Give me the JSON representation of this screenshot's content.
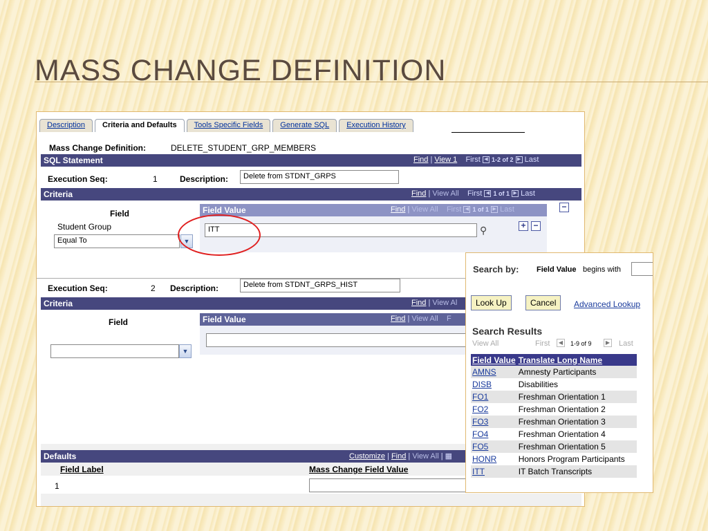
{
  "slide": {
    "title": "MASS CHANGE DEFINITION"
  },
  "tabs": [
    "Description",
    "Criteria and Defaults",
    "Tools Specific Fields",
    "Generate SQL",
    "Execution History"
  ],
  "definition": {
    "label": "Mass Change Definition:",
    "value": "DELETE_STUDENT_GRP_MEMBERS"
  },
  "sql_bar": {
    "title": "SQL Statement",
    "find": "Find",
    "sep": "|",
    "view": "View 1",
    "first": "First",
    "count": "1-2 of 2",
    "last": "Last"
  },
  "exec1": {
    "seq_label": "Execution Seq:",
    "seq_value": "1",
    "desc_label": "Description:",
    "desc_value": "Delete from STDNT_GRPS",
    "criteria_bar": {
      "title": "Criteria",
      "find": "Find",
      "sep": "|",
      "view_all": "View All",
      "first": "First",
      "count": "1 of 1",
      "last": "Last"
    },
    "field_header": "Field",
    "field_name": "Student Group",
    "operator": "Equal To",
    "fv_bar": {
      "title": "Field Value",
      "find": "Find",
      "sep": "|",
      "view_all": "View All",
      "first": "First",
      "count": "1 of 1",
      "last": "Last"
    },
    "field_value": "ITT"
  },
  "exec2": {
    "seq_label": "Execution Seq:",
    "seq_value": "2",
    "desc_label": "Description:",
    "desc_value": "Delete from STDNT_GRPS_HIST",
    "criteria_bar": {
      "title": "Criteria",
      "find": "Find",
      "sep": "|",
      "view_all": "View Al"
    },
    "field_header": "Field",
    "fv_bar": {
      "title": "Field Value",
      "find": "Find",
      "sep": "|",
      "view_all": "View All",
      "first": "F"
    }
  },
  "defaults": {
    "title": "Defaults",
    "customize": "Customize",
    "sep": "|",
    "find": "Find",
    "view_all": "View All",
    "col_field_label": "Field Label",
    "col_mass_change": "Mass Change Field Value",
    "row_num": "1"
  },
  "lookup": {
    "search_by_label": "Search by:",
    "search_by_field": "Field Value",
    "search_by_mode": "begins with",
    "lookup_btn": "Look Up",
    "cancel_btn": "Cancel",
    "advanced": "Advanced Lookup",
    "results_title": "Search Results",
    "view_all": "View All",
    "first": "First",
    "count": "1-9 of 9",
    "last": "Last",
    "col_value": "Field Value",
    "col_name": "Translate Long Name",
    "rows": [
      {
        "code": "AMNS",
        "name": "Amnesty Participants"
      },
      {
        "code": "DISB",
        "name": "Disabilities"
      },
      {
        "code": "FO1",
        "name": "Freshman Orientation 1"
      },
      {
        "code": "FO2",
        "name": "Freshman Orientation 2"
      },
      {
        "code": "FO3",
        "name": "Freshman Orientation 3"
      },
      {
        "code": "FO4",
        "name": "Freshman Orientation 4"
      },
      {
        "code": "FO5",
        "name": "Freshman Orientation 5"
      },
      {
        "code": "HONR",
        "name": "Honors Program Participants"
      },
      {
        "code": "ITT",
        "name": "IT Batch Transcripts"
      }
    ]
  },
  "colors": {
    "header_bar": "#46477e",
    "sub_bar": "#8d93c4",
    "highlight": "#e02020",
    "link": "#1a3b9c"
  }
}
